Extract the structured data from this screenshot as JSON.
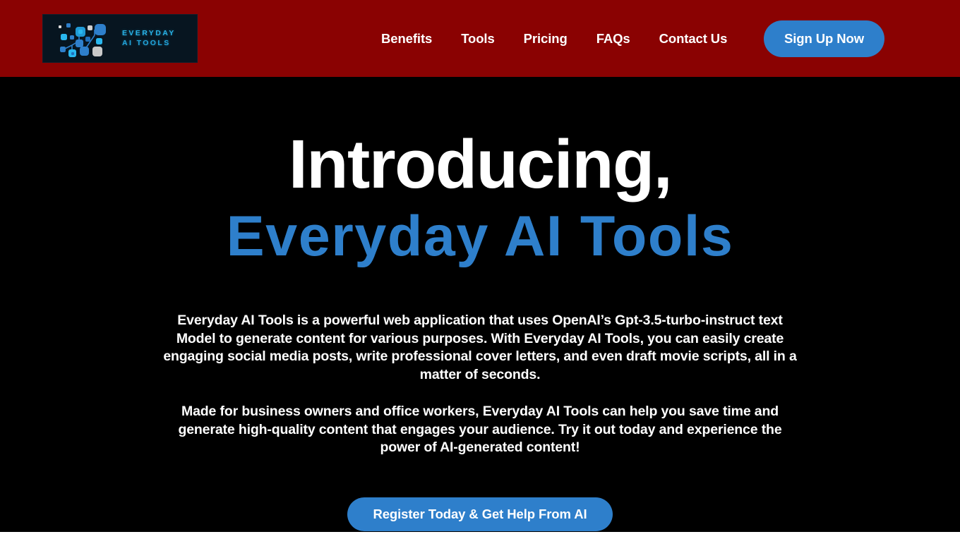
{
  "theme": {
    "header_bg": "#8a0202",
    "body_bg": "#000000",
    "accent_blue": "#2e7fcb",
    "logo_cyan": "#28b2e6",
    "logo_panel_bg": "#071520",
    "text_white": "#ffffff"
  },
  "header": {
    "logo": {
      "icon": "ai-network-nodes-icon",
      "line1": "EVERYDAY",
      "line2": "AI TOOLS"
    },
    "nav": [
      {
        "label": "Benefits"
      },
      {
        "label": "Tools"
      },
      {
        "label": "Pricing"
      },
      {
        "label": "FAQs"
      },
      {
        "label": "Contact Us"
      }
    ],
    "signup_label": "Sign Up Now"
  },
  "hero": {
    "title": "Introducing,",
    "subtitle": "Everyday AI Tools",
    "paragraph_1": "Everyday AI Tools is a powerful web application that uses OpenAI’s Gpt-3.5-turbo-instruct text Model to generate content for various purposes. With Everyday AI Tools, you can easily create engaging social media posts, write professional cover letters, and even draft movie scripts, all in a matter of seconds.",
    "paragraph_2": "Made for business owners and office workers, Everyday AI Tools can help you save time and generate high-quality content that engages your audience. Try it out today and experience the power of AI-generated content!",
    "cta_label": "Register Today & Get Help From AI"
  }
}
